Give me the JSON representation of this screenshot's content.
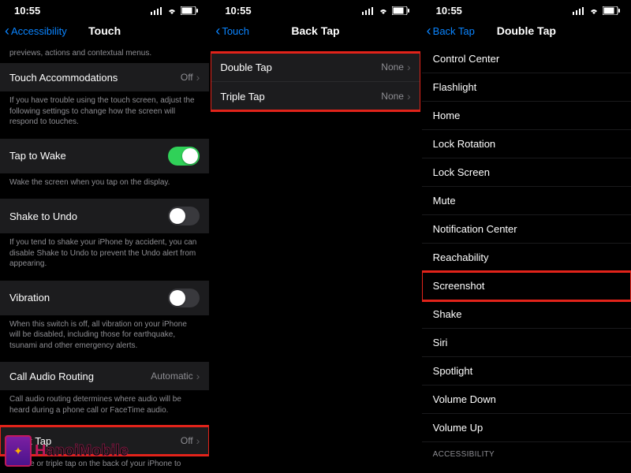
{
  "status": {
    "time": "10:55"
  },
  "panel1": {
    "back": "Accessibility",
    "title": "Touch",
    "top_truncated": "previews, actions and contextual menus.",
    "rows": {
      "touch_accom": {
        "label": "Touch Accommodations",
        "value": "Off"
      },
      "touch_accom_footer": "If you have trouble using the touch screen, adjust the following settings to change how the screen will respond to touches.",
      "tap_wake": {
        "label": "Tap to Wake"
      },
      "tap_wake_footer": "Wake the screen when you tap on the display.",
      "shake": {
        "label": "Shake to Undo"
      },
      "shake_footer": "If you tend to shake your iPhone by accident, you can disable Shake to Undo to prevent the Undo alert from appearing.",
      "vibration": {
        "label": "Vibration"
      },
      "vibration_footer": "When this switch is off, all vibration on your iPhone will be disabled, including those for earthquake, tsunami and other emergency alerts.",
      "call_audio": {
        "label": "Call Audio Routing",
        "value": "Automatic"
      },
      "call_audio_footer": "Call audio routing determines where audio will be heard during a phone call or FaceTime audio.",
      "back_tap": {
        "label": "Back Tap",
        "value": "Off"
      },
      "back_tap_footer": "Double or triple tap on the back of your iPhone to"
    }
  },
  "panel2": {
    "back": "Touch",
    "title": "Back Tap",
    "double": {
      "label": "Double Tap",
      "value": "None"
    },
    "triple": {
      "label": "Triple Tap",
      "value": "None"
    }
  },
  "panel3": {
    "back": "Back Tap",
    "title": "Double Tap",
    "items": [
      "Control Center",
      "Flashlight",
      "Home",
      "Lock Rotation",
      "Lock Screen",
      "Mute",
      "Notification Center",
      "Reachability",
      "Screenshot",
      "Shake",
      "Siri",
      "Spotlight",
      "Volume Down",
      "Volume Up"
    ],
    "section_header": "Accessibility"
  },
  "watermark": {
    "brand_h": "H",
    "brand_rest": "anoiMobile"
  }
}
